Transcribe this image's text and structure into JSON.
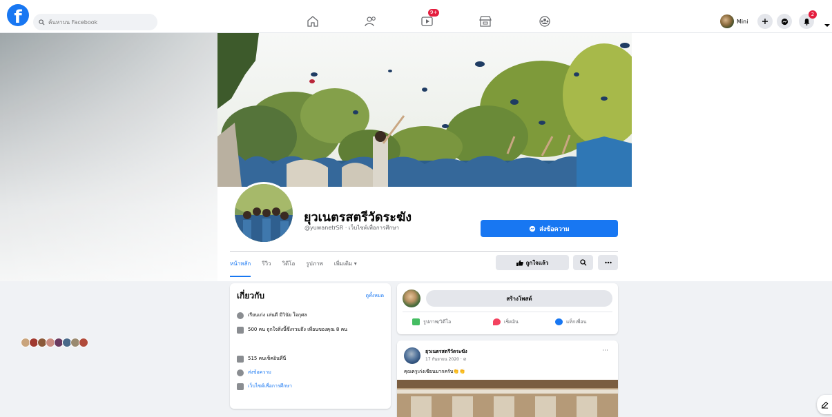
{
  "topbar": {
    "logo": "f",
    "search_placeholder": "ค้นหาบน Facebook",
    "nav_items": [
      {
        "icon": "home-icon"
      },
      {
        "icon": "friends-icon"
      },
      {
        "icon": "watch-icon",
        "badge": "9+"
      },
      {
        "icon": "marketplace-icon"
      },
      {
        "icon": "groups-icon"
      }
    ],
    "profile_name": "Mini",
    "notifications_count": "2"
  },
  "page": {
    "name": "ยุวเนตรสตรีวัดระฆัง",
    "handle": "@yuwanetrSR · เว็บไซต์เพื่อการศึกษา",
    "message_button": "ส่งข้อความ",
    "like_button": "ถูกใจแล้ว"
  },
  "tabs": [
    {
      "label": "หน้าหลัก",
      "active": true
    },
    {
      "label": "รีวิว",
      "active": false
    },
    {
      "label": "วิดีโอ",
      "active": false
    },
    {
      "label": "รูปภาพ",
      "active": false
    },
    {
      "label": "เพิ่มเติม ▾",
      "active": false
    }
  ],
  "intro": {
    "title": "เกี่ยวกับ",
    "see_all": "ดูทั้งหมด",
    "rows": {
      "info": "เรียนเก่ง เล่นดี มีวินัย ใจกุศล",
      "likes": "500 คน ถูกใจสิ่งนี้ซึ่งรวมถึง เพื่อนของคุณ 8 คน",
      "checkins": "515 คนเช็คอินที่นี่",
      "message": "ส่งข้อความ",
      "category": "เว็บไซต์เพื่อการศึกษา"
    }
  },
  "create_post": {
    "button": "สร้างโพสต์",
    "photo_video": "รูปภาพ/วิดีโอ",
    "checkin": "เช็คอิน",
    "tag_friends": "แท็กเพื่อน"
  },
  "post": {
    "author": "ยุวเนตรสตรีวัดระฆัง",
    "date": "17 กันยายน 2020 · ⊘",
    "text": "คุณครูเก่งเซียนมากครับ👏👏",
    "more": "···"
  },
  "colors": {
    "primary": "#1877f2",
    "background": "#f0f2f5",
    "badge": "#e41e3f"
  }
}
